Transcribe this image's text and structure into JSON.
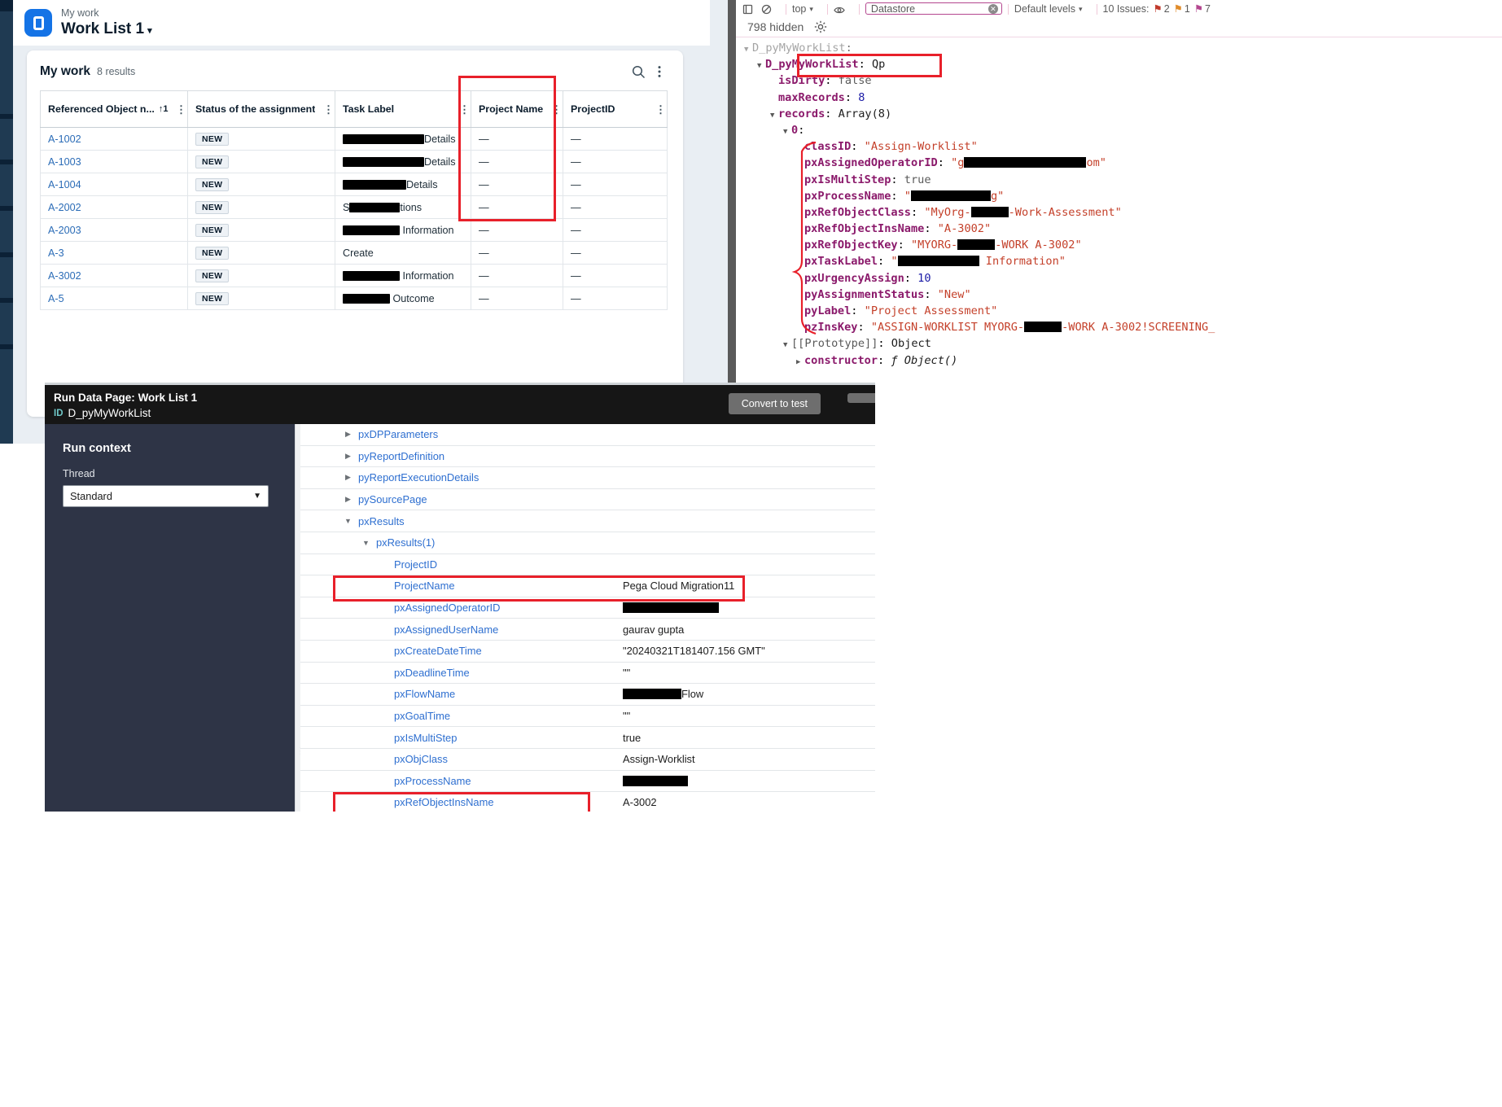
{
  "pega": {
    "breadcrumb": "My work",
    "title": "Work List 1",
    "title_caret": "▾",
    "card": {
      "heading": "My work",
      "results_count": "8 results",
      "search_icon": "search-icon",
      "more_icon": "kebab-menu-icon"
    },
    "table": {
      "columns": [
        {
          "label": "Referenced Object n...",
          "sort": "↑1",
          "has_sort": true
        },
        {
          "label": "Status of the assignment",
          "sort": "",
          "has_sort": false
        },
        {
          "label": "Task Label",
          "sort": "",
          "has_sort": false
        },
        {
          "label": "Project Name",
          "sort": "",
          "has_sort": false
        },
        {
          "label": "ProjectID",
          "sort": "",
          "has_sort": false
        }
      ],
      "rows": [
        {
          "ref": "A-1002",
          "status": "NEW",
          "task_redacted_w": 100,
          "task": "Details",
          "project_name": "—",
          "project_id": "—"
        },
        {
          "ref": "A-1003",
          "status": "NEW",
          "task_redacted_w": 100,
          "task": "Details",
          "project_name": "—",
          "project_id": "—"
        },
        {
          "ref": "A-1004",
          "status": "NEW",
          "task_redacted_w": 78,
          "task": "Details",
          "project_name": "—",
          "project_id": "—"
        },
        {
          "ref": "A-2002",
          "status": "NEW",
          "task_prefix": "S",
          "task_redacted_w": 62,
          "task": "tions",
          "project_name": "—",
          "project_id": "—"
        },
        {
          "ref": "A-2003",
          "status": "NEW",
          "task_redacted_w": 70,
          "task": " Information",
          "project_name": "—",
          "project_id": "—"
        },
        {
          "ref": "A-3",
          "status": "NEW",
          "task_redacted_w": 0,
          "task": "Create",
          "project_name": "—",
          "project_id": "—"
        },
        {
          "ref": "A-3002",
          "status": "NEW",
          "task_redacted_w": 70,
          "task": " Information",
          "project_name": "—",
          "project_id": "—"
        },
        {
          "ref": "A-5",
          "status": "NEW",
          "task_redacted_w": 58,
          "task": " Outcome",
          "project_name": "—",
          "project_id": "—"
        }
      ]
    }
  },
  "devtools": {
    "toolbar": {
      "context": "top",
      "context_caret": "▾",
      "filter_value": "Datastore",
      "levels": "Default levels",
      "levels_caret": "▾",
      "issues": "10 Issues:",
      "issue_counts": [
        "2",
        "1",
        "7"
      ]
    },
    "hidden_text": "798 hidden",
    "gear_icon": "settings-gear-icon",
    "console": [
      {
        "indent": 0,
        "arrow": "▼",
        "key": "D_pyMyWorkList",
        "keytype": "plain",
        "sep": ":",
        "val": "",
        "valtype": "none",
        "faded": true
      },
      {
        "indent": 1,
        "arrow": "▼",
        "key": "D_pyMyWorkList",
        "keytype": "key",
        "sep": ":",
        "val": "Qp",
        "valtype": "obj"
      },
      {
        "indent": 2,
        "arrow": "",
        "key": "isDirty",
        "keytype": "key",
        "sep": ":",
        "val": "false",
        "valtype": "bool"
      },
      {
        "indent": 2,
        "arrow": "",
        "key": "maxRecords",
        "keytype": "key",
        "sep": ":",
        "val": "8",
        "valtype": "num"
      },
      {
        "indent": 2,
        "arrow": "▼",
        "key": "records",
        "keytype": "key",
        "sep": ":",
        "val": "Array(8)",
        "valtype": "obj"
      },
      {
        "indent": 3,
        "arrow": "▼",
        "key": "0",
        "keytype": "key",
        "sep": ":",
        "val": "",
        "valtype": "none"
      },
      {
        "indent": 4,
        "arrow": "",
        "key": "classID",
        "keytype": "key",
        "sep": ":",
        "val": "\"Assign-Worklist\"",
        "valtype": "str"
      },
      {
        "indent": 4,
        "arrow": "",
        "key": "pxAssignedOperatorID",
        "keytype": "key",
        "sep": ":",
        "val_pre": "\"g",
        "redact_w": 150,
        "val_post": "om\"",
        "valtype": "str-redact"
      },
      {
        "indent": 4,
        "arrow": "",
        "key": "pxIsMultiStep",
        "keytype": "key",
        "sep": ":",
        "val": "true",
        "valtype": "bool"
      },
      {
        "indent": 4,
        "arrow": "",
        "key": "pxProcessName",
        "keytype": "key",
        "sep": ":",
        "val_pre": "\"",
        "redact_w": 98,
        "val_post": "g\"",
        "valtype": "str-redact"
      },
      {
        "indent": 4,
        "arrow": "",
        "key": "pxRefObjectClass",
        "keytype": "key",
        "sep": ":",
        "val_pre": "\"MyOrg-",
        "redact_w": 46,
        "val_post": "-Work-Assessment\"",
        "valtype": "str-redact"
      },
      {
        "indent": 4,
        "arrow": "",
        "key": "pxRefObjectInsName",
        "keytype": "key",
        "sep": ":",
        "val": "\"A-3002\"",
        "valtype": "str"
      },
      {
        "indent": 4,
        "arrow": "",
        "key": "pxRefObjectKey",
        "keytype": "key",
        "sep": ":",
        "val_pre": "\"MYORG-",
        "redact_w": 46,
        "val_post": "-WORK A-3002\"",
        "valtype": "str-redact"
      },
      {
        "indent": 4,
        "arrow": "",
        "key": "pxTaskLabel",
        "keytype": "key",
        "sep": ":",
        "val_pre": "\"",
        "redact_w": 100,
        "val_post": " Information\"",
        "valtype": "str-redact"
      },
      {
        "indent": 4,
        "arrow": "",
        "key": "pxUrgencyAssign",
        "keytype": "key",
        "sep": ":",
        "val": "10",
        "valtype": "num"
      },
      {
        "indent": 4,
        "arrow": "",
        "key": "pyAssignmentStatus",
        "keytype": "key",
        "sep": ":",
        "val": "\"New\"",
        "valtype": "str"
      },
      {
        "indent": 4,
        "arrow": "",
        "key": "pyLabel",
        "keytype": "key",
        "sep": ":",
        "val": "\"Project Assessment\"",
        "valtype": "str"
      },
      {
        "indent": 4,
        "arrow": "",
        "key": "pzInsKey",
        "keytype": "key",
        "sep": ":",
        "val_pre": "\"ASSIGN-WORKLIST MYORG-",
        "redact_w": 46,
        "val_post": "-WORK A-3002!SCREENING_",
        "valtype": "str-redact"
      },
      {
        "indent": 3,
        "arrow": "▼",
        "key": "[[Prototype]]",
        "keytype": "plain",
        "sep": ":",
        "val": "Object",
        "valtype": "obj"
      },
      {
        "indent": 4,
        "arrow": "▶",
        "key": "constructor",
        "keytype": "ctor",
        "sep": ":",
        "val": "ƒ Object()",
        "valtype": "ital"
      }
    ]
  },
  "rundp": {
    "title_run": "Run",
    "title_label": "Data Page:",
    "title_name": "Work List 1",
    "id_label": "ID",
    "id_value": "D_pyMyWorkList",
    "convert_button": "Convert to test",
    "run_context_heading": "Run context",
    "thread_label": "Thread",
    "thread_value": "Standard",
    "thread_options": [
      "Standard"
    ],
    "properties": [
      {
        "depth": 0,
        "tw": "▶",
        "name": "pxDPParameters",
        "value": ""
      },
      {
        "depth": 0,
        "tw": "▶",
        "name": "pyReportDefinition",
        "value": ""
      },
      {
        "depth": 0,
        "tw": "▶",
        "name": "pyReportExecutionDetails",
        "value": ""
      },
      {
        "depth": 0,
        "tw": "▶",
        "name": "pySourcePage",
        "value": ""
      },
      {
        "depth": 0,
        "tw": "▼",
        "name": "pxResults",
        "value": ""
      },
      {
        "depth": 1,
        "tw": "▼",
        "name": "pxResults(1)",
        "value": ""
      },
      {
        "depth": 2,
        "tw": "",
        "name": "ProjectID",
        "value": ""
      },
      {
        "depth": 2,
        "tw": "",
        "name": "ProjectName",
        "value": "Pega Cloud Migration11",
        "highlight": true
      },
      {
        "depth": 2,
        "tw": "",
        "name": "pxAssignedOperatorID",
        "value": "",
        "redact_w": 118
      },
      {
        "depth": 2,
        "tw": "",
        "name": "pxAssignedUserName",
        "value": "gaurav gupta"
      },
      {
        "depth": 2,
        "tw": "",
        "name": "pxCreateDateTime",
        "value": "\"20240321T181407.156 GMT\""
      },
      {
        "depth": 2,
        "tw": "",
        "name": "pxDeadlineTime",
        "value": "\"\""
      },
      {
        "depth": 2,
        "tw": "",
        "name": "pxFlowName",
        "value": "Flow",
        "redact_w": 72
      },
      {
        "depth": 2,
        "tw": "",
        "name": "pxGoalTime",
        "value": "\"\""
      },
      {
        "depth": 2,
        "tw": "",
        "name": "pxIsMultiStep",
        "value": "true"
      },
      {
        "depth": 2,
        "tw": "",
        "name": "pxObjClass",
        "value": "Assign-Worklist"
      },
      {
        "depth": 2,
        "tw": "",
        "name": "pxProcessName",
        "value": "",
        "redact_w": 80
      },
      {
        "depth": 2,
        "tw": "",
        "name": "pxRefObjectInsName",
        "value": "A-3002",
        "highlight": true
      }
    ]
  },
  "colors": {
    "accent_blue": "#1473e6",
    "link_blue": "#2b6cb7",
    "highlight_red": "#e8202a",
    "devtools_key": "#8b1a6b",
    "devtools_string": "#c4402a",
    "modal_dark": "#161616",
    "modal_panel": "#2e3446"
  }
}
